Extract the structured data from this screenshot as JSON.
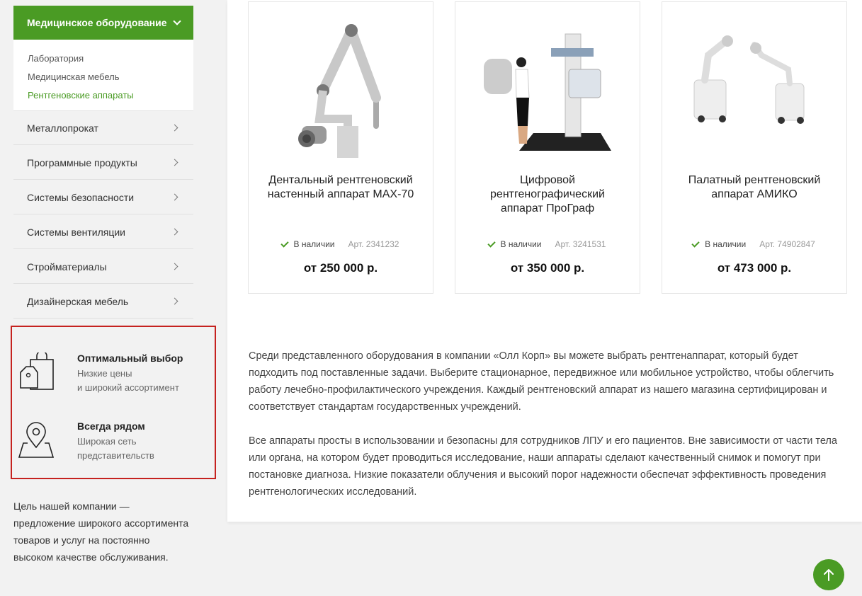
{
  "sidebar": {
    "category": "Медицинское оборудование",
    "subcategories": [
      "Лаборатория",
      "Медицинская мебель",
      "Рентгеновские аппараты"
    ],
    "menu": [
      "Металлопрокат",
      "Программные продукты",
      "Системы безопасности",
      "Системы вентиляции",
      "Стройматериалы",
      "Дизайнерская мебель"
    ]
  },
  "features": [
    {
      "title": "Оптимальный выбор",
      "line1": "Низкие цены",
      "line2": "и широкий ассортимент",
      "icon": "shopping-bags-icon"
    },
    {
      "title": "Всегда рядом",
      "line1": "Широкая сеть",
      "line2": "представительств",
      "icon": "map-pin-icon"
    }
  ],
  "about": "Цель нашей компании — предложение широкого ассортимента товаров и услуг на постоянно высоком качестве обслуживания.",
  "products": [
    {
      "name": "Дентальный рентгеновский настенный аппарат MAX-70",
      "stock": "В наличии",
      "art": "Арт. 2341232",
      "price": "от 250 000 р."
    },
    {
      "name": "Цифровой рентгенографический аппарат ПроГраф",
      "stock": "В наличии",
      "art": "Арт. 3241531",
      "price": "от 350 000 р."
    },
    {
      "name": "Палатный рентгеновский аппарат АМИКО",
      "stock": "В наличии",
      "art": "Арт. 74902847",
      "price": "от 473 000 р."
    }
  ],
  "description": {
    "p1": "Среди представленного оборудования в компании «Олл Корп» вы можете выбрать рентгенаппарат, который будет подходить под поставленные задачи. Выберите стационарное, передвижное или мобильное устройство, чтобы облегчить работу лечебно-профилактического учреждения. Каждый рентгеновский аппарат из нашего магазина сертифицирован и соответствует стандартам государственных учреждений.",
    "p2": "Все аппараты просты в использовании и безопасны для сотрудников ЛПУ и его пациентов. Вне зависимости от части тела или органа, на котором будет проводиться исследование, наши аппараты сделают качественный снимок и помогут при постановке диагноза. Низкие показатели облучения и высокий порог надежности обеспечат эффективность проведения рентгенологических исследований."
  },
  "colors": {
    "accent": "#4a9b24",
    "highlight_border": "#c5221f"
  }
}
